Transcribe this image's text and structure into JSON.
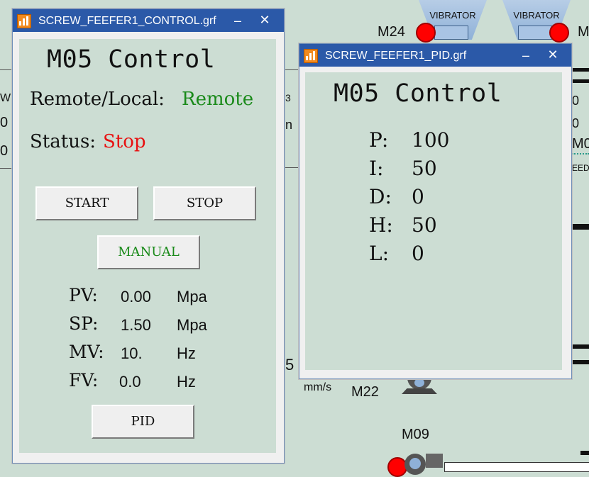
{
  "background": {
    "vibrator_left_label": "VIBRATOR",
    "vibrator_right_label": "VIBRATOR",
    "motor_m24": "M24",
    "motor_m_right": "M",
    "motor_m22": "M22",
    "motor_m09": "M09",
    "unit_mms": "mm/s",
    "value_5": "5",
    "edge_text_w": "W",
    "edge_text_0a": "0",
    "edge_text_0b": "0",
    "edge_text_3": "3",
    "edge_text_n": "n",
    "edge_text_r0": "0",
    "edge_text_r0b": "0",
    "edge_text_mo": "M0",
    "edge_text_eed": "EED",
    "colors": {
      "alarm_red": "#ff0000",
      "scada_bg": "#ccddd3"
    }
  },
  "control_window": {
    "title": "SCREW_FEEFER1_CONTROL.grf",
    "heading": "M05 Control",
    "remote_local_label": "Remote/Local:",
    "remote_local_value": "Remote",
    "status_label": "Status:",
    "status_value": "Stop",
    "start_label": "START",
    "stop_label": "STOP",
    "manual_label": "MANUAL",
    "pid_label": "PID",
    "rows": [
      {
        "label": "PV:",
        "value": "0.00",
        "unit": "Mpa"
      },
      {
        "label": "SP:",
        "value": "1.50",
        "unit": "Mpa"
      },
      {
        "label": "MV:",
        "value": "10.",
        "unit": "Hz"
      },
      {
        "label": "FV:",
        "value": "0.0",
        "unit": "Hz"
      }
    ],
    "colors": {
      "remote": "#1a8a1a",
      "stop": "#e81010",
      "manual": "#1a8a1a"
    }
  },
  "pid_window": {
    "title": "SCREW_FEEFER1_PID.grf",
    "heading": "M05 Control",
    "params": [
      {
        "label": "P:",
        "value": "100"
      },
      {
        "label": "I:",
        "value": "50"
      },
      {
        "label": "D:",
        "value": "0"
      },
      {
        "label": "H:",
        "value": "50"
      },
      {
        "label": "L:",
        "value": "0"
      }
    ]
  }
}
